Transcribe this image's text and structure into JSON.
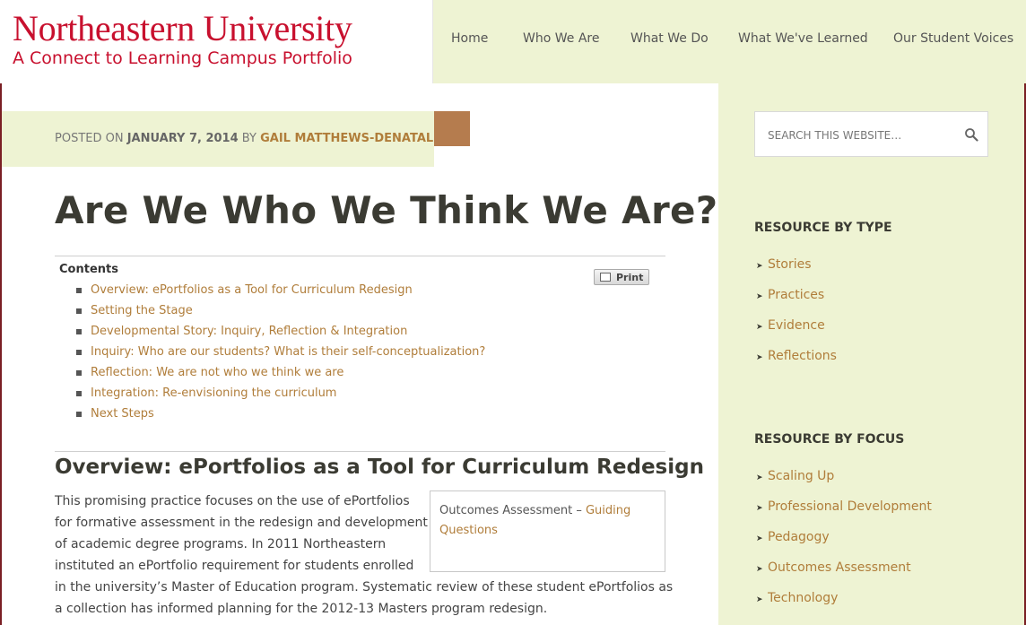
{
  "header": {
    "logo_title": "Northeastern University",
    "logo_subtitle": "A Connect to Learning Campus Portfolio",
    "nav": [
      "Home",
      "Who We Are",
      "What We Do",
      "What We've Learned",
      "Our Student Voices"
    ]
  },
  "post": {
    "posted_on_label": "POSTED ON",
    "date": "JANUARY 7, 2014",
    "by_label": "BY",
    "author": "GAIL MATTHEWS-DENATALE",
    "title": "Are We Who We Think We Are?"
  },
  "toc": {
    "title": "Contents",
    "print_label": "Print",
    "items": [
      "Overview: ePortfolios as a Tool for Curriculum Redesign",
      "Setting the Stage",
      "Developmental Story: Inquiry, Reflection & Integration",
      "Inquiry: Who are our students? What is their self-conceptualization?",
      "Reflection: We are not who we think we are",
      "Integration: Re-envisioning the curriculum",
      "Next Steps"
    ]
  },
  "section": {
    "heading": "Overview: ePortfolios as a Tool for Curriculum Redesign",
    "callout_prefix": "Outcomes Assessment – ",
    "callout_link_1": "Guiding",
    "callout_link_2": "Questions",
    "paragraph_lines": [
      "This promising practice focuses on the use of ePortfolios",
      "for formative assessment in the redesign and development",
      "of academic degree programs. In 2011 Northeastern",
      "instituted an ePortfolio requirement for students enrolled",
      "in the university’s Master of Education program. Systematic review of these student ePortfolios as",
      "a collection has informed planning for the 2012-13 Masters program redesign."
    ]
  },
  "sidebar": {
    "search_placeholder": "SEARCH THIS WEBSITE…",
    "search_icon": "search-icon",
    "type_heading": "RESOURCE BY TYPE",
    "type_items": [
      "Stories",
      "Practices",
      "Evidence",
      "Reflections"
    ],
    "focus_heading": "RESOURCE BY FOCUS",
    "focus_items": [
      "Scaling Up",
      "Professional Development",
      "Pedagogy",
      "Outcomes Assessment",
      "Technology"
    ]
  },
  "colors": {
    "brand_red": "#c8102e",
    "light_green_bg": "#eef3d3",
    "link_gold": "#b07d3a",
    "accent_brown": "#b57c4e"
  }
}
